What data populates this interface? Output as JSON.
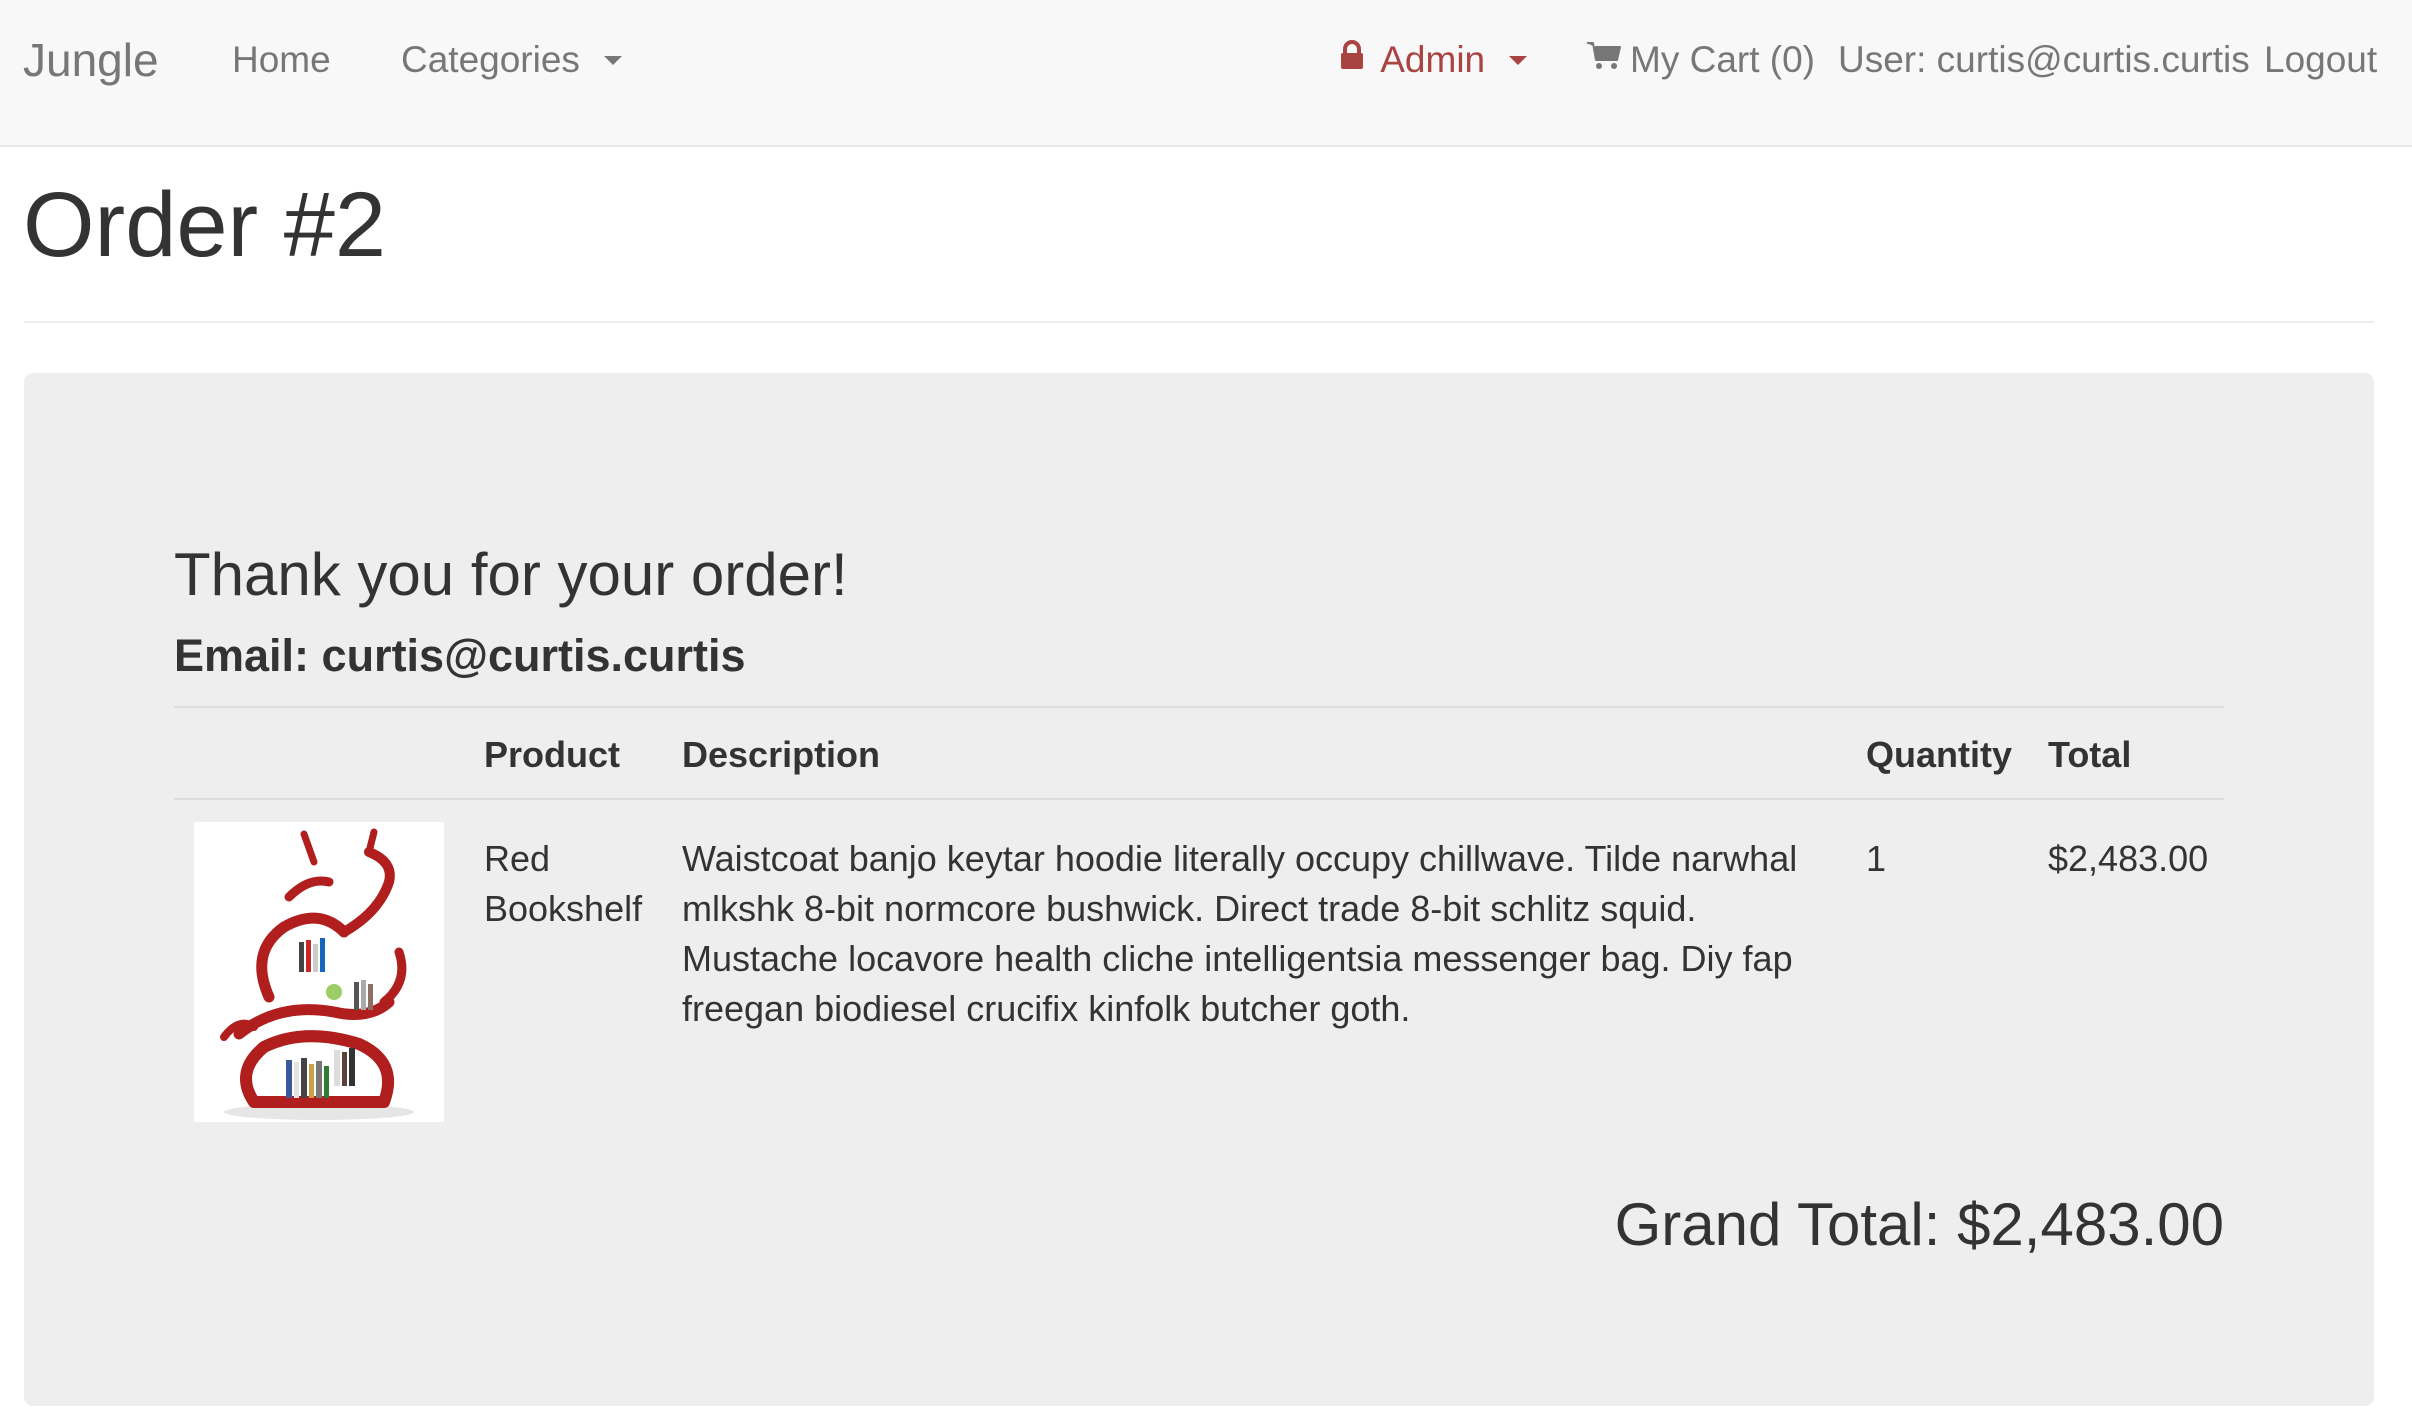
{
  "navbar": {
    "brand": "Jungle",
    "home": "Home",
    "categories": "Categories",
    "admin": "Admin",
    "cart": "My Cart (0)",
    "user": "User: curtis@curtis.curtis",
    "logout": "Logout"
  },
  "page": {
    "title": "Order #2"
  },
  "order": {
    "thanks": "Thank you for your order!",
    "email": "Email: curtis@curtis.curtis",
    "columns": {
      "product": "Product",
      "description": "Description",
      "quantity": "Quantity",
      "total": "Total"
    },
    "items": [
      {
        "product": "Red Bookshelf",
        "description": "Waistcoat banjo keytar hoodie literally occupy chillwave. Tilde narwhal mlkshk 8-bit normcore bushwick. Direct trade 8-bit schlitz squid. Mustache locavore health cliche intelligentsia messenger bag. Diy fap freegan biodiesel crucifix kinfolk butcher goth.",
        "quantity": "1",
        "total": "$2,483.00"
      }
    ],
    "grand_total_label": "Grand Total: ",
    "grand_total_value": "$2,483.00"
  },
  "colors": {
    "navbar_bg": "#f8f8f8",
    "nav_text": "#777777",
    "admin_accent": "#a94442",
    "jumbotron_bg": "#eeeeee",
    "text": "#333333",
    "bookshelf_red": "#b01e1e"
  },
  "icons": {
    "admin": "lock-icon",
    "cart": "cart-icon",
    "dropdown": "chevron-down-icon"
  }
}
